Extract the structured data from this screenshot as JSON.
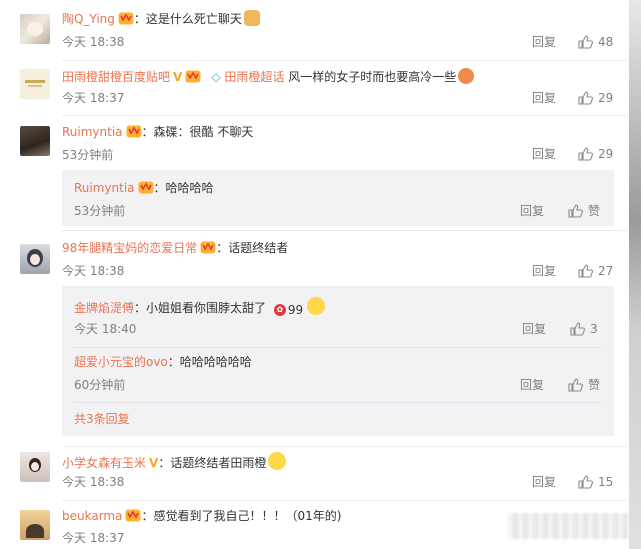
{
  "comments": [
    {
      "user": "陶Q_Ying",
      "text": "：这是什么死亡聊天",
      "time": "今天 18:38",
      "reply": "回复",
      "likes": "48"
    },
    {
      "user": "田雨橙甜橙百度贴吧",
      "tag": "田雨橙超话",
      "text": "风一样的女子时而也要高冷一些",
      "time": "今天 18:37",
      "reply": "回复",
      "likes": "29"
    },
    {
      "user": "Ruimyntia",
      "text": "：森碟：很酷 不聊天",
      "time": "53分钟前",
      "reply": "回复",
      "likes": "29",
      "sub": [
        {
          "user": "Ruimyntia",
          "text": "：哈哈哈哈",
          "time": "53分钟前",
          "reply": "回复",
          "likes": "赞"
        }
      ]
    },
    {
      "user": "98年腿精宝妈的恋爱日常",
      "text": "：话题终结者",
      "time": "今天 18:38",
      "reply": "回复",
      "likes": "27",
      "sub": [
        {
          "user": "金牌焰湜傅",
          "text": "：小姐姐看你围脖太甜了",
          "badge": "99",
          "time": "今天 18:40",
          "reply": "回复",
          "likes": "3"
        },
        {
          "user": "超爱小元宝的ovo",
          "text": "：哈哈哈哈哈哈",
          "time": "60分钟前",
          "reply": "回复",
          "likes": "赞"
        }
      ],
      "more": "共3条回复"
    },
    {
      "user": "小学女森有玉米",
      "text": "：话题终结者田雨橙",
      "time": "今天 18:38",
      "reply": "回复",
      "likes": "15"
    },
    {
      "user": "beukarma",
      "text": "：感觉看到了我自己！！！（01年的)",
      "time": "今天 18:37"
    }
  ],
  "colors": {
    "username": "#eb7350",
    "meta": "#808080",
    "subbox": "#f2f2f5",
    "tag": "#48b1e0"
  },
  "icons": {
    "like": "thumb-up-icon",
    "vip": "vip-crown-icon",
    "verified": "verified-v-icon",
    "gem": "gem-icon"
  }
}
